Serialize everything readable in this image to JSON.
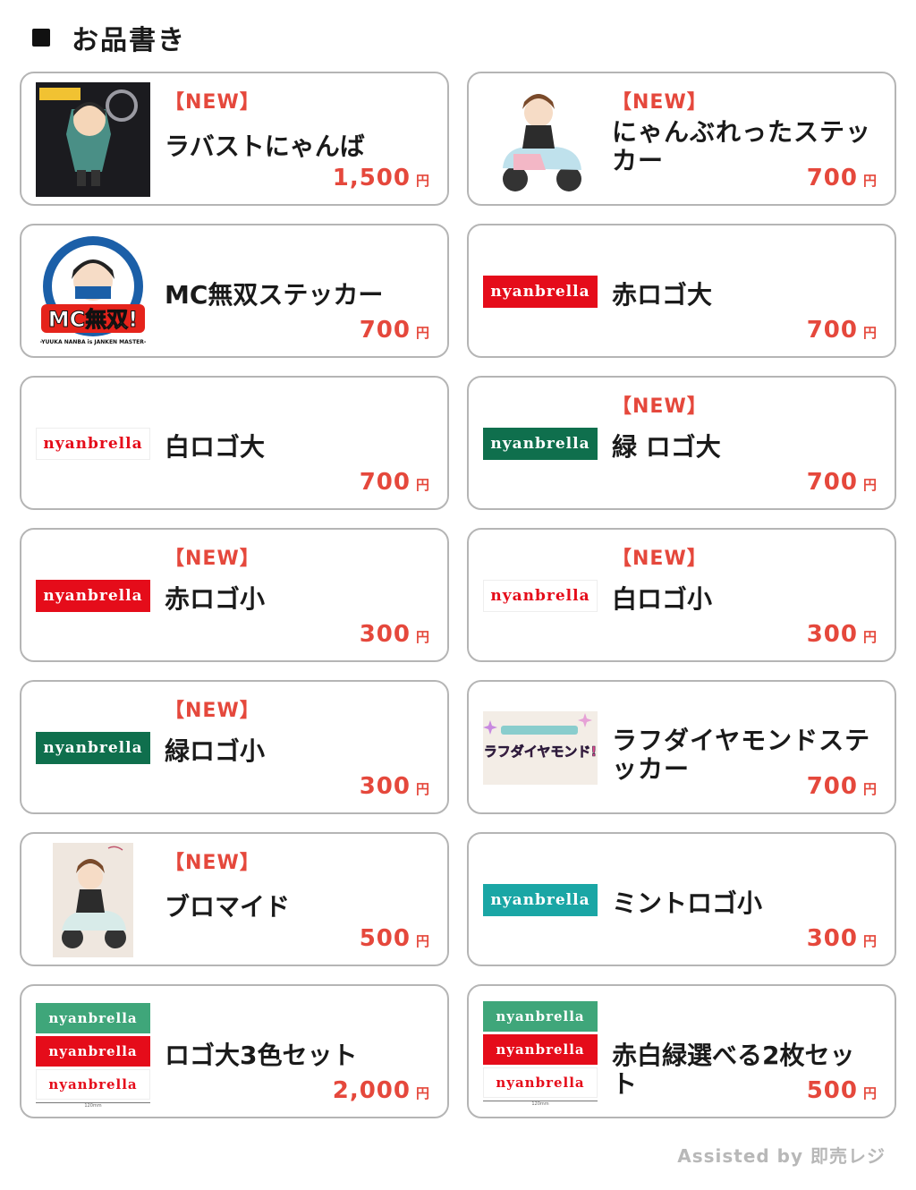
{
  "header": {
    "title": "お品書き"
  },
  "brand": {
    "logo_text": "nyanbrella"
  },
  "currency": "円",
  "items": [
    {
      "badge": "【NEW】",
      "name": "ラバストにゃんば",
      "price": "1,500"
    },
    {
      "badge": "【NEW】",
      "name": "にゃんぶれったステッカー",
      "price": "700"
    },
    {
      "badge": "",
      "name": "MC無双ステッカー",
      "price": "700",
      "thumb_text": "MC無双!",
      "thumb_caption": "-YUUKA NANBA is JANKEN MASTER-"
    },
    {
      "badge": "",
      "name": "赤ロゴ大",
      "price": "700"
    },
    {
      "badge": "",
      "name": "白ロゴ大",
      "price": "700"
    },
    {
      "badge": "【NEW】",
      "name": "緑 ロゴ大",
      "price": "700"
    },
    {
      "badge": "【NEW】",
      "name": "赤ロゴ小",
      "price": "300"
    },
    {
      "badge": "【NEW】",
      "name": "白ロゴ小",
      "price": "300"
    },
    {
      "badge": "【NEW】",
      "name": "緑ロゴ小",
      "price": "300"
    },
    {
      "badge": "",
      "name": "ラフダイヤモンドステッカー",
      "price": "700",
      "thumb_text": "ラフダイヤモンド!"
    },
    {
      "badge": "【NEW】",
      "name": "ブロマイド",
      "price": "500"
    },
    {
      "badge": "",
      "name": "ミントロゴ小",
      "price": "300"
    },
    {
      "badge": "",
      "name": "ロゴ大3色セット",
      "price": "2,000",
      "ruler": "120mm"
    },
    {
      "badge": "",
      "name": "赤白緑選べる2枚セット",
      "price": "500",
      "ruler": "120mm"
    }
  ],
  "colors": {
    "accent": "#e5483c",
    "logo_red": "#e50c1a",
    "logo_green": "#0f6f4d",
    "logo_mint": "#1aa6a5"
  },
  "footer": {
    "text": "Assisted by 即売レジ"
  }
}
